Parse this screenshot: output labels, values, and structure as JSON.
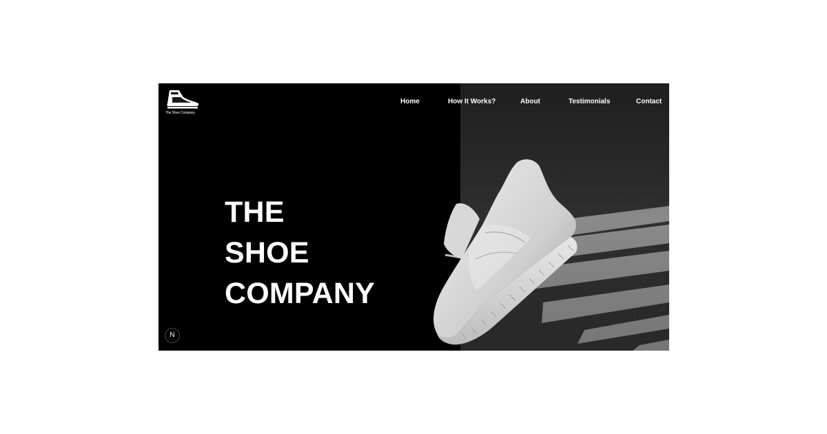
{
  "brand": {
    "logo_text": "The Shoe Company",
    "logo_icon": "sneaker-icon"
  },
  "nav": {
    "items": [
      {
        "label": "Home"
      },
      {
        "label": "How It Works?"
      },
      {
        "label": "About"
      },
      {
        "label": "Testimonials"
      },
      {
        "label": "Contact"
      }
    ]
  },
  "hero": {
    "line1": "THE",
    "line2": "SHOE",
    "line3": "COMPANY",
    "image": "white-sneaker-on-asphalt-crosswalk"
  },
  "badge": {
    "label": "N",
    "icon": "nextjs-badge-icon"
  },
  "colors": {
    "background": "#000000",
    "text": "#ffffff",
    "asphalt": "#2f2f2f",
    "stripe": "#8c8c8c"
  }
}
